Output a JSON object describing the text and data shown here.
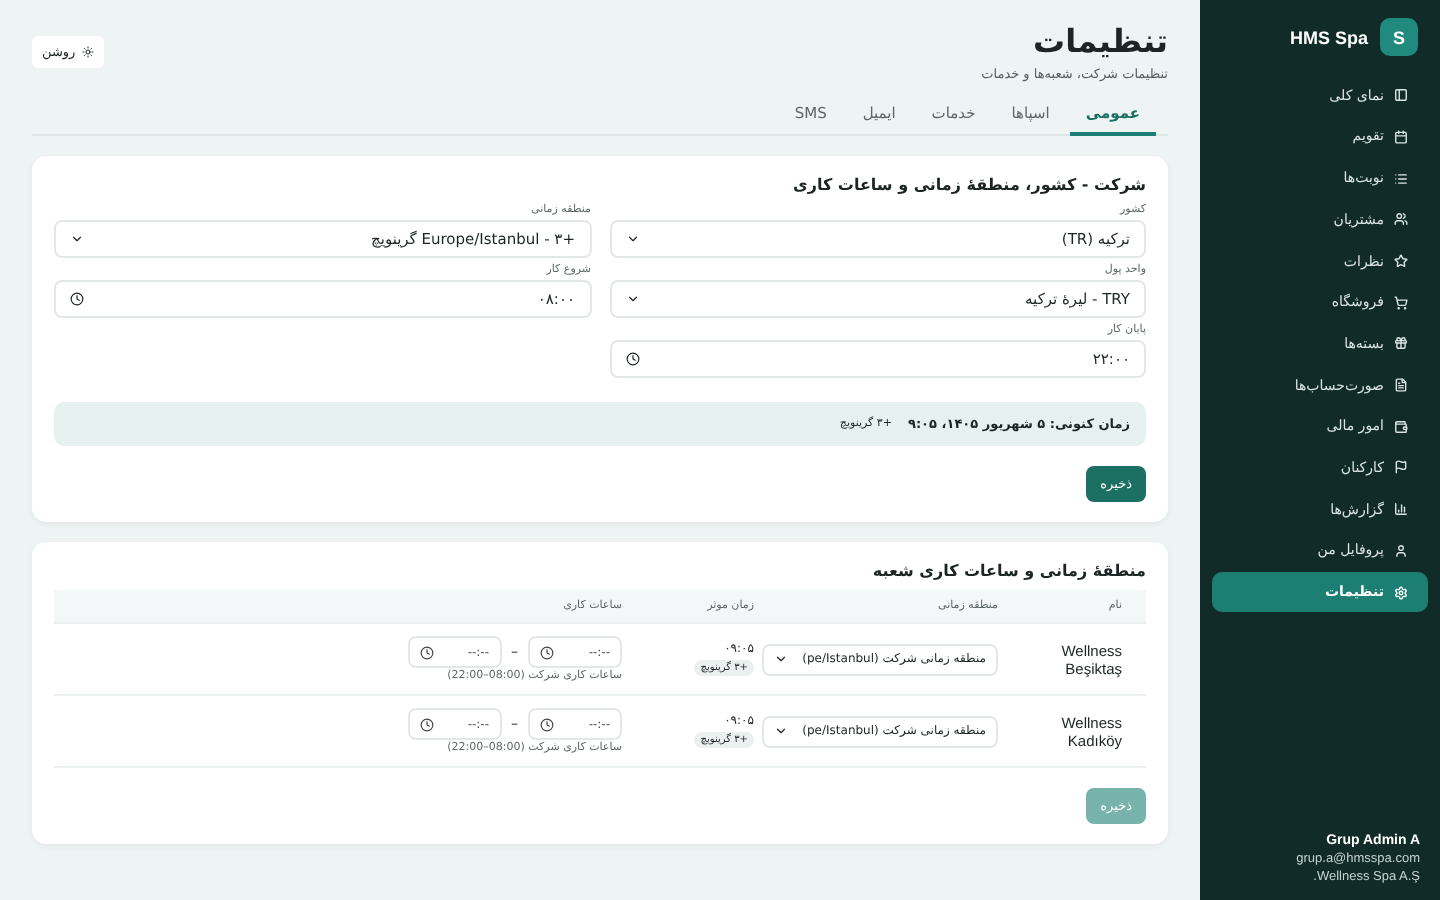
{
  "sidebar": {
    "logo": "S",
    "brand": "HMS Spa",
    "items": [
      {
        "label": "نمای کلی",
        "selected": false
      },
      {
        "label": "تقویم",
        "selected": false
      },
      {
        "label": "نوبت‌ها",
        "selected": false
      },
      {
        "label": "مشتریان",
        "selected": false
      },
      {
        "label": "نظرات",
        "selected": false
      },
      {
        "label": "فروشگاه",
        "selected": false
      },
      {
        "label": "بسته‌ها",
        "selected": false
      },
      {
        "label": "صورت‌حساب‌ها",
        "selected": false
      },
      {
        "label": "امور مالی",
        "selected": false
      },
      {
        "label": "کارکنان",
        "selected": false
      },
      {
        "label": "گزارش‌ها",
        "selected": false
      },
      {
        "label": "پروفایل من",
        "selected": false
      },
      {
        "label": "تنظیمات",
        "selected": true
      }
    ],
    "user": {
      "name": "Grup Admin A",
      "email": "grup.a@hmsspa.com",
      "company": "Wellness Spa A.Ş."
    }
  },
  "header": {
    "title": "تنظیمات",
    "subtitle": "تنظیمات شرکت، شعبه‌ها و خدمات",
    "theme_button": "روشن"
  },
  "tabs": [
    {
      "label": "عمومی",
      "selected": true
    },
    {
      "label": "اسپاها",
      "selected": false
    },
    {
      "label": "خدمات",
      "selected": false
    },
    {
      "label": "ایمیل",
      "selected": false
    },
    {
      "label": "SMS",
      "selected": false
    }
  ],
  "company_card": {
    "title": "شرکت - کشور، منطقهٔ زمانی و ساعات کاری",
    "fields": [
      {
        "label": "کشور",
        "kind": "select",
        "value": "ترکیه (TR)"
      },
      {
        "label": "منطقه زمانی",
        "kind": "select",
        "value": "+۳ - Europe/Istanbul گرینویچ"
      },
      {
        "label": "واحد پول",
        "kind": "select",
        "value": "TRY - لیرهٔ ترکیه"
      },
      {
        "label": "شروع کار",
        "kind": "time",
        "value": "۰۸:۰۰"
      },
      {
        "label": "پایان کار",
        "kind": "time",
        "value": "۲۲:۰۰"
      }
    ],
    "current_time": {
      "label": "زمان کنونی: ۵ شهریور ۱۴۰۵، ۹:۰۵",
      "offset": "+۳ گرینویچ"
    },
    "save_button": {
      "label": "ذخیره",
      "disabled": false
    }
  },
  "branch_card": {
    "title": "منطقهٔ زمانی و ساعات کاری شعبه",
    "columns": [
      "نام",
      "منطقه زمانی",
      "زمان موثر",
      "ساعات کاری"
    ],
    "range_separator": "–",
    "rows": [
      {
        "name": "Wellness Beşiktaş",
        "timezone": "منطقه زمانی شرکت (pe/Istanbul)",
        "time": "۰۹:۰۵",
        "offset": "+۳ گرینویچ",
        "from": "--:--",
        "to": "--:--",
        "hint": "ساعات کاری شرکت (08:00–22:00)"
      },
      {
        "name": "Wellness Kadıköy",
        "timezone": "منطقه زمانی شرکت (pe/Istanbul)",
        "time": "۰۹:۰۵",
        "offset": "+۳ گرینویچ",
        "from": "--:--",
        "to": "--:--",
        "hint": "ساعات کاری شرکت (08:00–22:00)"
      }
    ],
    "save_button": {
      "label": "ذخیره",
      "disabled": true
    }
  }
}
